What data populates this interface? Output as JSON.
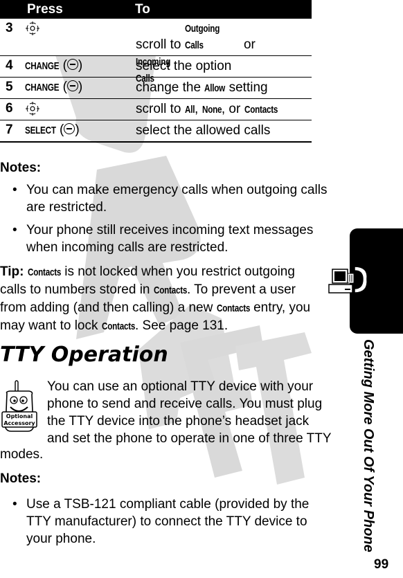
{
  "table": {
    "headers": [
      "Press",
      "To"
    ],
    "rows": [
      {
        "step": "3",
        "press_icon": "nav-key-icon",
        "press_label": "",
        "to": [
          "scroll to ",
          {
            "b": "Outgoing Calls"
          },
          " or ",
          {
            "br": true
          },
          {
            "b": "Incoming Calls"
          }
        ]
      },
      {
        "step": "4",
        "press_icon": "soft-key-icon",
        "press_label": "CHANGE",
        "to": [
          "select the option"
        ]
      },
      {
        "step": "5",
        "press_icon": "soft-key-icon",
        "press_label": "CHANGE",
        "to": [
          "change the ",
          {
            "b": "Allow"
          },
          " setting"
        ]
      },
      {
        "step": "6",
        "press_icon": "nav-key-icon",
        "press_label": "",
        "to": [
          "scroll to ",
          {
            "b": "All"
          },
          ", ",
          {
            "b": "None"
          },
          ", or ",
          {
            "b": "Contacts"
          }
        ]
      },
      {
        "step": "7",
        "press_icon": "soft-key-icon",
        "press_label": "SELECT",
        "to": [
          "select the allowed calls"
        ]
      }
    ]
  },
  "notes1": {
    "heading": "Notes:",
    "bullets": [
      "You can make emergency calls when outgoing calls are restricted.",
      "Your phone still receives incoming text messages when incoming calls are restricted."
    ]
  },
  "tip": {
    "label": "Tip:",
    "parts": [
      {
        "b": "Contacts"
      },
      " is not locked when you restrict outgoing calls to numbers stored in ",
      {
        "b": "Contacts"
      },
      ". To prevent a user from adding (and then calling) a new ",
      {
        "b": "Contacts"
      },
      " entry, you may want to lock ",
      {
        "b": "Contacts"
      },
      ". See page 131."
    ]
  },
  "section": {
    "title": "TTY Operation",
    "icon_label_1": "Optional",
    "icon_label_2": "Accessory",
    "intro": "You can use an optional TTY device with your phone to send and receive calls. You must plug the TTY device into the phone’s headset jack and set the phone to operate in one of three TTY",
    "intro_cont": "modes."
  },
  "notes2": {
    "heading": "Notes:",
    "bullets": [
      "Use a TSB-121 compliant cable (provided by the TTY manufacturer) to connect the TTY device to your phone."
    ]
  },
  "sidebar": {
    "chapter": "Getting More Out Of Your Phone",
    "tab_icon": "computer-phone-icon"
  },
  "page_number": "99",
  "watermark": "DRAFT"
}
